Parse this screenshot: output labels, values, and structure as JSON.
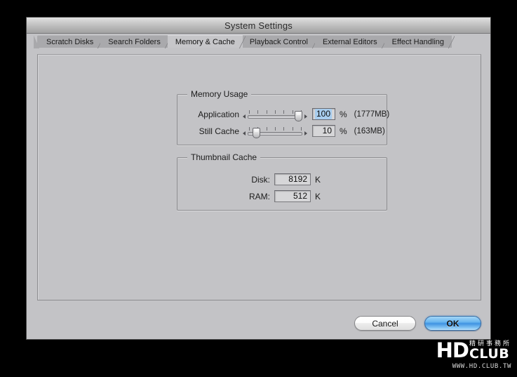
{
  "window": {
    "title": "System Settings"
  },
  "tabs": [
    {
      "id": "scratch-disks",
      "label": "Scratch Disks",
      "active": false
    },
    {
      "id": "search-folders",
      "label": "Search Folders",
      "active": false
    },
    {
      "id": "memory-cache",
      "label": "Memory & Cache",
      "active": true
    },
    {
      "id": "playback-control",
      "label": "Playback Control",
      "active": false
    },
    {
      "id": "external-editors",
      "label": "External Editors",
      "active": false
    },
    {
      "id": "effect-handling",
      "label": "Effect Handling",
      "active": false
    }
  ],
  "memory_usage": {
    "legend": "Memory Usage",
    "application": {
      "label": "Application",
      "value": "100",
      "unit": "%",
      "note": "(1777MB)",
      "slider_percent": 100,
      "selected": true
    },
    "still_cache": {
      "label": "Still Cache",
      "value": "10",
      "unit": "%",
      "note": "(163MB)",
      "slider_percent": 10,
      "selected": false
    }
  },
  "thumbnail_cache": {
    "legend": "Thumbnail Cache",
    "disk": {
      "label": "Disk:",
      "value": "8192",
      "unit": "K"
    },
    "ram": {
      "label": "RAM:",
      "value": "512",
      "unit": "K"
    }
  },
  "buttons": {
    "cancel": "Cancel",
    "ok": "OK"
  },
  "watermark": {
    "hd": "HD",
    "cjk": "精研事務所",
    "club": "CLUB",
    "url": "WWW.HD.CLUB.TW"
  },
  "colors": {
    "window_bg": "#c3c3c6",
    "titlebar_top": "#e2e2e2",
    "titlebar_bottom": "#a2a2a2",
    "tab_inactive": "#a9a9ac",
    "tab_active": "#c6c6c9",
    "ok_accent": "#3f93e2",
    "selection": "#a8cdee",
    "field_bg": "#d6d6d8",
    "desktop": "#000000"
  }
}
